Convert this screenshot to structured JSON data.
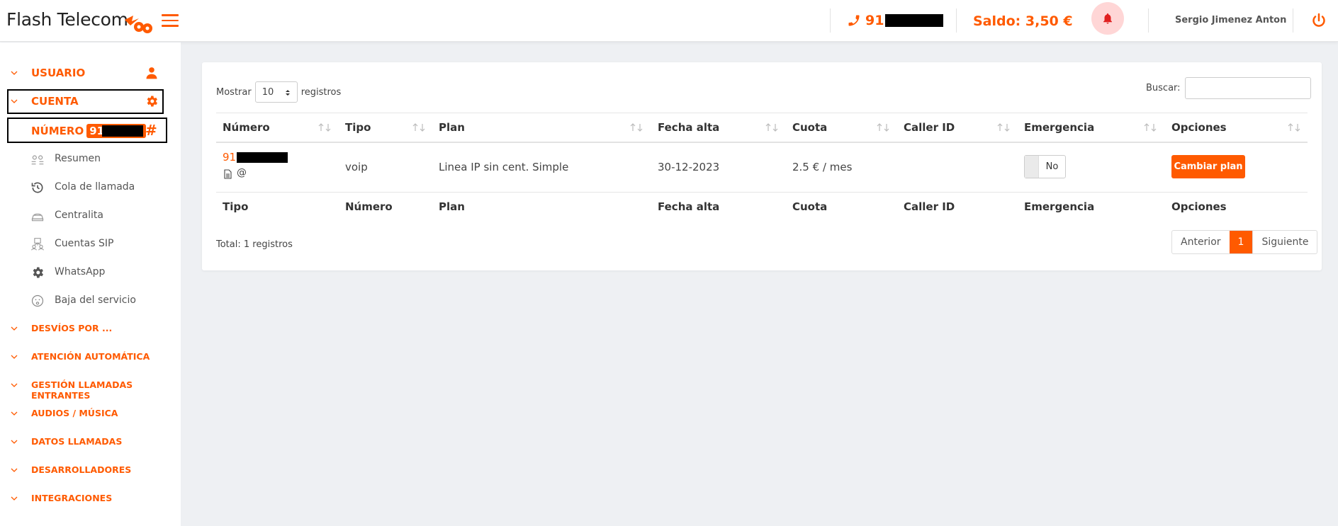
{
  "header": {
    "brand": "Flash Telecom",
    "phone_prefix": "91",
    "saldo": "Saldo: 3,50 €",
    "user": "Sergio Jimenez Anton"
  },
  "sidebar": {
    "usuario": "USUARIO",
    "cuenta": "CUENTA",
    "numero": "NÚMERO",
    "numero_prefix": "91",
    "sub_items": [
      {
        "label": "Resumen",
        "icon": "summary-icon"
      },
      {
        "label": "Cola de llamada",
        "icon": "history-icon"
      },
      {
        "label": "Centralita",
        "icon": "switchboard-icon"
      },
      {
        "label": "Cuentas SIP",
        "icon": "sip-accounts-icon"
      },
      {
        "label": "WhatsApp",
        "icon": "gear-icon"
      },
      {
        "label": "Baja del servicio",
        "icon": "sad-face-icon"
      }
    ],
    "sections": [
      "DESVÍOS POR ...",
      "ATENCIÓN AUTOMÁTICA",
      "GESTIÓN LLAMADAS ENTRANTES",
      "AUDIOS / MÚSICA",
      "DATOS LLAMADAS",
      "DESARROLLADORES",
      "INTEGRACIONES"
    ]
  },
  "table_controls": {
    "show_label": "Mostrar",
    "show_value": "10",
    "records_label": "registros",
    "search_label": "Buscar:",
    "search_value": ""
  },
  "table": {
    "headers": [
      "Número",
      "Tipo",
      "Plan",
      "Fecha alta",
      "Cuota",
      "Caller ID",
      "Emergencia",
      "Opciones"
    ],
    "footer_headers": [
      "Tipo",
      "Número",
      "Plan",
      "Fecha alta",
      "Cuota",
      "Caller ID",
      "Emergencia",
      "Opciones"
    ],
    "row": {
      "numero_prefix": "91",
      "tipo": "voip",
      "plan": "Linea IP sin cent. Simple",
      "fecha_alta": "30-12-2023",
      "cuota": "2.5 € / mes",
      "caller_id": "",
      "emergencia": "No",
      "opciones": "Cambiar plan"
    }
  },
  "footer": {
    "total": "Total: 1 registros",
    "prev": "Anterior",
    "page": "1",
    "next": "Siguiente"
  },
  "colors": {
    "accent": "#ff5a00",
    "background": "#eef0f3"
  }
}
